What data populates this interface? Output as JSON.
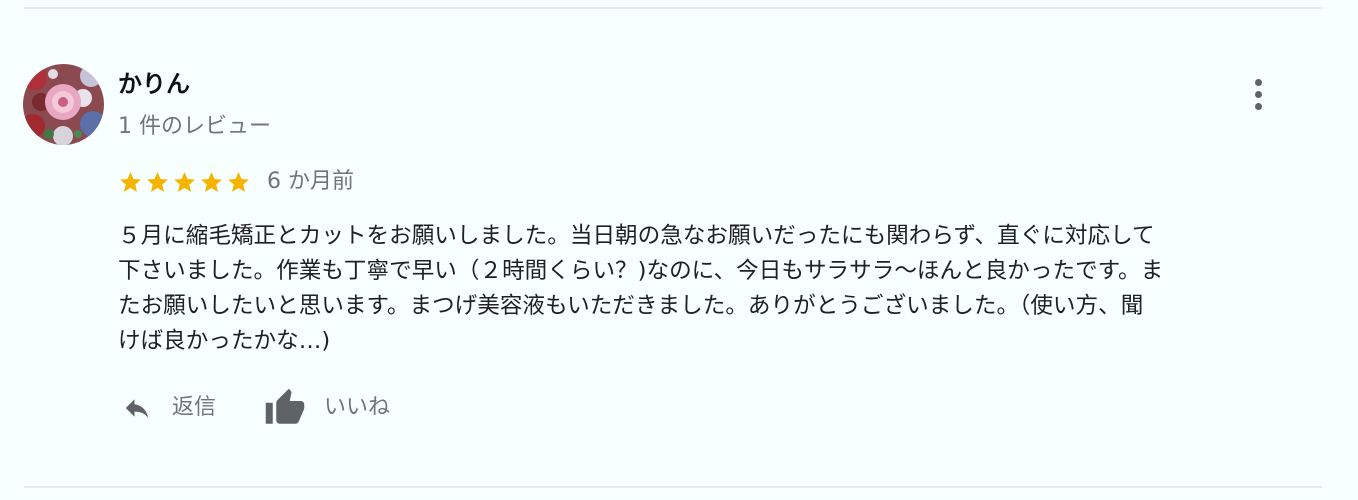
{
  "review": {
    "reviewer": {
      "name": "かりん",
      "review_count": "1 件のレビュー",
      "avatar_icon": "flower-photo-avatar"
    },
    "menu_icon": "more-vert-icon",
    "rating": {
      "stars": 5,
      "max_stars": 5,
      "star_color": "#f4b400",
      "time_ago": "6 か月前"
    },
    "text": "５月に縮毛矯正とカットをお願いしました。当日朝の急なお願いだったにも関わらず、直ぐに対応して\n下さいました。作業も丁寧で早い（２時間くらい？)なのに、今日もサラサラ〜ほんと良かったです。ま\nたお願いしたいと思います。まつげ美容液もいただきました。ありがとうございました。（使い方、聞\nけば良かったかな…)",
    "actions": {
      "reply_label": "返信",
      "reply_icon": "reply-icon",
      "like_label": "いいね",
      "like_icon": "thumb-up-icon"
    }
  },
  "colors": {
    "background": "#f7ffff",
    "secondary_text": "#70757a",
    "icon_gray": "#5f6368"
  }
}
